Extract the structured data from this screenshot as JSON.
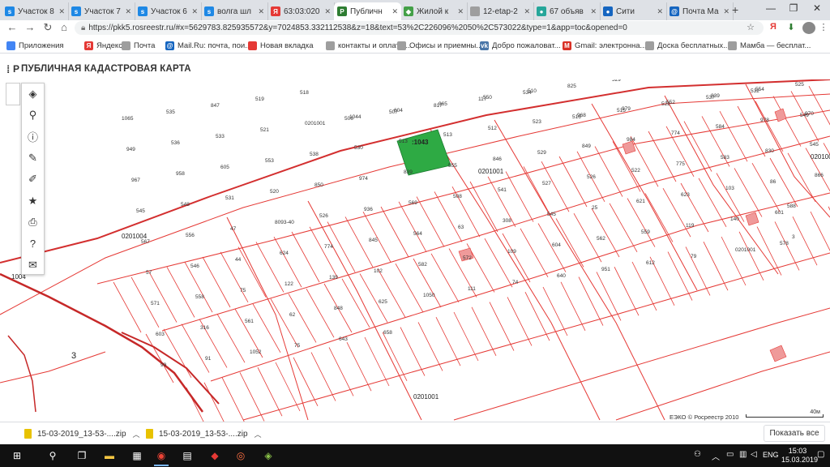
{
  "browser": {
    "tabs": [
      {
        "title": "Участок 8",
        "favicon_color": "#1e88e5",
        "favicon": "s"
      },
      {
        "title": "Участок 7",
        "favicon_color": "#1e88e5",
        "favicon": "s"
      },
      {
        "title": "Участок 6",
        "favicon_color": "#1e88e5",
        "favicon": "s"
      },
      {
        "title": "волга шл",
        "favicon_color": "#1e88e5",
        "favicon": "s"
      },
      {
        "title": "63:03:020",
        "favicon_color": "#e53935",
        "favicon": "Я"
      },
      {
        "title": "Публичн",
        "favicon_color": "#2e7d32",
        "favicon": "P",
        "active": true
      },
      {
        "title": "Жилой к",
        "favicon_color": "#43a047",
        "favicon": "◆"
      },
      {
        "title": "12-etap-2",
        "favicon_color": "#9e9e9e",
        "favicon": ""
      },
      {
        "title": "67 объяв",
        "favicon_color": "#26a69a",
        "favicon": "●"
      },
      {
        "title": "Сити",
        "favicon_color": "#1565c0",
        "favicon": "●"
      },
      {
        "title": "Почта Ма",
        "favicon_color": "#1565c0",
        "favicon": "@"
      }
    ],
    "new_tab": "+",
    "url": "https://pkk5.rosreestr.ru/#x=5629783.825935572&y=7024853.332112538&z=18&text=53%2C226096%2050%2C573022&type=1&app=toc&opened=0",
    "bookmarks": [
      {
        "label": "Приложения",
        "icon_color": "#4285f4"
      },
      {
        "label": "Яндекс",
        "icon_color": "#e53935",
        "icon": "Я"
      },
      {
        "label": "Почта",
        "icon_color": "#9e9e9e"
      },
      {
        "label": "Mail.Ru: почта, пои...",
        "icon_color": "#1565c0",
        "icon": "@"
      },
      {
        "label": "Новая вкладка",
        "icon_color": "#e53935"
      },
      {
        "label": "контакты и оплата ...",
        "icon_color": "#9e9e9e"
      },
      {
        "label": "Офисы и приемны...",
        "icon_color": "#9e9e9e"
      },
      {
        "label": "Добро пожаловат...",
        "icon_color": "#4a76a8",
        "icon": "vk"
      },
      {
        "label": "Gmail: электронна...",
        "icon_color": "#d93025",
        "icon": "M"
      },
      {
        "label": "Доска бесплатных...",
        "icon_color": "#9e9e9e"
      },
      {
        "label": "Мамба — бесплат...",
        "icon_color": "#9e9e9e"
      }
    ]
  },
  "page": {
    "title": "ПУБЛИЧНАЯ КАДАСТРОВАЯ КАРТА",
    "tools": [
      "layers-icon",
      "search-icon",
      "info-icon",
      "pencil-icon",
      "measure-icon",
      "star-icon",
      "print-icon",
      "help-icon",
      "mail-icon"
    ],
    "attribution": "ЕЭКО © Росреестр 2010",
    "scale": "40м"
  },
  "map": {
    "colors": {
      "boundary": "#e53935",
      "highlight": "#2eaa44",
      "label": "#333333",
      "road": "#d32f2f"
    },
    "selected_parcel": ":1043",
    "quarter_labels": [
      "0201004",
      "0201001",
      "0201001",
      "0201001",
      "1004"
    ],
    "parcel_labels": [
      "1065",
      "535",
      "847",
      "519",
      "518",
      "506",
      "507",
      "817",
      "117",
      "534",
      "825",
      "529",
      "633",
      "516",
      "514",
      "508",
      "949",
      "536",
      "533",
      "521",
      "0201001",
      "1044",
      "604",
      "965",
      "550",
      "510",
      "516",
      "515",
      "522",
      "537",
      "532",
      "525",
      "967",
      "958",
      "605",
      "553",
      "538",
      "530",
      "513",
      "513",
      "512",
      "523",
      "968",
      "979",
      "552",
      "839",
      "554",
      "549",
      "545",
      "548",
      "531",
      "520",
      "850",
      "974",
      "839",
      "555",
      "846",
      "529",
      "849",
      "984",
      "774",
      "584",
      "978",
      "970",
      "567",
      "556",
      "47",
      "8093-40",
      "526",
      "936",
      "569",
      "508",
      "541",
      "527",
      "526",
      "522",
      "775",
      "583",
      "830",
      "545",
      "57",
      "546",
      "44",
      "624",
      "774",
      "845",
      "564",
      "63",
      "308",
      "545",
      "25",
      "621",
      "623",
      "103",
      "86",
      "866",
      "571",
      "558",
      "75",
      "122",
      "139",
      "102",
      "582",
      "572",
      "109",
      "604",
      "562",
      "559",
      "119",
      "140",
      "601",
      "588",
      "603",
      "316",
      "561",
      "62",
      "848",
      "625",
      "1050",
      "111",
      "74",
      "640",
      "951",
      "612",
      "79",
      "0201001",
      "578",
      "3",
      "99",
      "91",
      "1052",
      "75",
      "643",
      "658"
    ],
    "road_label": "3"
  },
  "downloads": {
    "items": [
      "15-03-2019_13-53-....zip",
      "15-03-2019_13-53-....zip"
    ],
    "show_all": "Показать все"
  },
  "taskbar": {
    "language": "ENG",
    "time": "15:03",
    "date": "15.03.2019"
  }
}
